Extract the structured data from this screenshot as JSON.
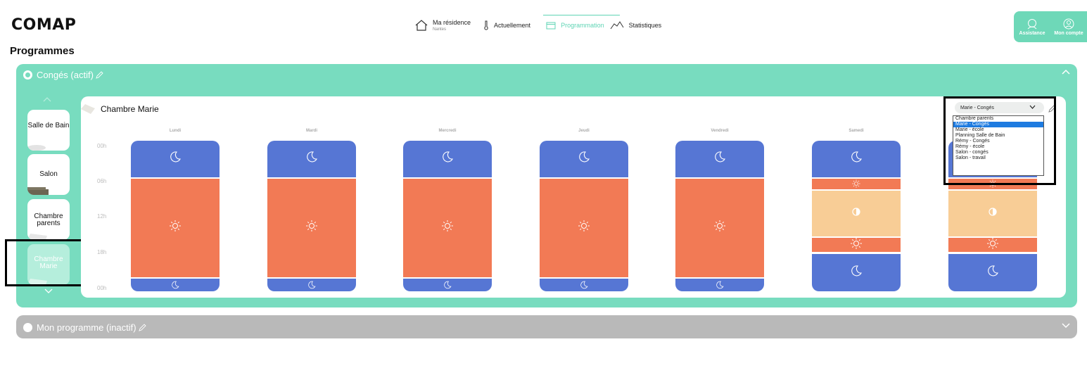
{
  "brand": {
    "logo": "COMAP"
  },
  "nav": {
    "residence_label": "Ma résidence",
    "residence_city": "Nantes",
    "current_label": "Actuellement",
    "programming_label": "Programmation",
    "stats_label": "Statistiques"
  },
  "header_actions": {
    "help_label": "Assistance",
    "account_label": "Mon compte"
  },
  "page_title": "Programmes",
  "active_program": {
    "title": "Congés (actif)"
  },
  "inactive_program": {
    "title": "Mon programme (inactif)"
  },
  "rooms": [
    {
      "label": "Salle de Bain"
    },
    {
      "label": "Salon"
    },
    {
      "label": "Chambre parents"
    },
    {
      "label": "Chambre Marie",
      "selected": true
    }
  ],
  "schedule": {
    "room_name": "Chambre Marie",
    "hours": [
      "00h",
      "06h",
      "12h",
      "18h",
      "00h"
    ],
    "days": [
      {
        "name": "Lundi",
        "segments": [
          {
            "mode": "night",
            "from": 0,
            "to": 6
          },
          {
            "mode": "comfort",
            "from": 6,
            "to": 22
          },
          {
            "mode": "night",
            "from": 22,
            "to": 24
          }
        ]
      },
      {
        "name": "Mardi",
        "segments": [
          {
            "mode": "night",
            "from": 0,
            "to": 6
          },
          {
            "mode": "comfort",
            "from": 6,
            "to": 22
          },
          {
            "mode": "night",
            "from": 22,
            "to": 24
          }
        ]
      },
      {
        "name": "Mercredi",
        "segments": [
          {
            "mode": "night",
            "from": 0,
            "to": 6
          },
          {
            "mode": "comfort",
            "from": 6,
            "to": 22
          },
          {
            "mode": "night",
            "from": 22,
            "to": 24
          }
        ]
      },
      {
        "name": "Jeudi",
        "segments": [
          {
            "mode": "night",
            "from": 0,
            "to": 6
          },
          {
            "mode": "comfort",
            "from": 6,
            "to": 22
          },
          {
            "mode": "night",
            "from": 22,
            "to": 24
          }
        ]
      },
      {
        "name": "Vendredi",
        "segments": [
          {
            "mode": "night",
            "from": 0,
            "to": 6
          },
          {
            "mode": "comfort",
            "from": 6,
            "to": 22
          },
          {
            "mode": "night",
            "from": 22,
            "to": 24
          }
        ]
      },
      {
        "name": "Samedi",
        "segments": [
          {
            "mode": "night",
            "from": 0,
            "to": 6
          },
          {
            "mode": "comfort",
            "from": 6,
            "to": 8
          },
          {
            "mode": "eco",
            "from": 8,
            "to": 15.5
          },
          {
            "mode": "comfort",
            "from": 15.5,
            "to": 18
          },
          {
            "mode": "night",
            "from": 18,
            "to": 24
          }
        ]
      },
      {
        "name": "",
        "segments": [
          {
            "mode": "night",
            "from": 0,
            "to": 6
          },
          {
            "mode": "comfort",
            "from": 6,
            "to": 8
          },
          {
            "mode": "eco",
            "from": 8,
            "to": 15.5
          },
          {
            "mode": "comfort",
            "from": 15.5,
            "to": 18
          },
          {
            "mode": "night",
            "from": 18,
            "to": 24
          }
        ]
      }
    ]
  },
  "program_select": {
    "value": "Marie - Congés",
    "options": [
      "Chambre parents",
      "Marie - Congés",
      "Marie - école",
      "Planning Salle de Bain",
      "Rémy - Congés",
      "Rémy - école",
      "Salon - congés",
      "Salon - travail"
    ],
    "highlighted": "Marie - Congés"
  },
  "colors": {
    "accent": "#78dcbf",
    "night": "#5676d4",
    "comfort": "#f27a55",
    "eco": "#f8cd96",
    "inactive": "#b9b9b9"
  },
  "icons": {
    "night": "moon-icon",
    "comfort": "sun-icon",
    "eco": "half-sun-icon"
  }
}
